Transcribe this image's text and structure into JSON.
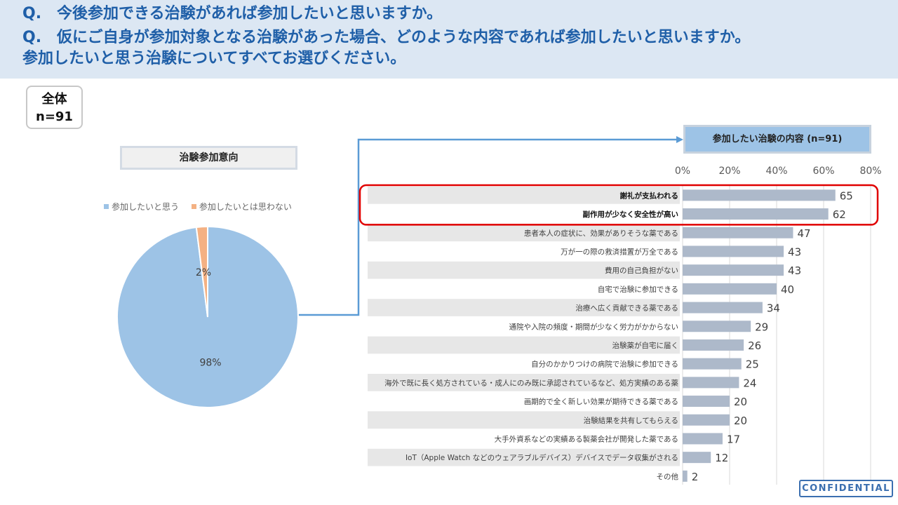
{
  "header": {
    "q1": "Q.　今後参加できる治験があれば参加したいと思いますか。",
    "q2": "Q.　仮にご自身が参加対象となる治験があった場合、どのような内容であれば参加したいと思いますか。",
    "q3": "参加したいと思う治験についてすべてお選びください。"
  },
  "total": {
    "label": "全体",
    "n": "n=91"
  },
  "footer": {
    "confidential": "CONFIDENTIAL"
  },
  "colors": {
    "pie_main": "#9dc3e6",
    "pie_minor": "#f4b183",
    "bar": "#adb9ca",
    "highlight": "#e00000",
    "connector": "#5b9bd5"
  },
  "chart_data": [
    {
      "type": "pie",
      "title": "治験参加意向",
      "legend_position": "top",
      "slices": [
        {
          "label": "参加したいと思う",
          "value": 98,
          "data_label": "98%",
          "color": "#9dc3e6"
        },
        {
          "label": "参加したいとは思わない",
          "value": 2,
          "data_label": "2%",
          "color": "#f4b183"
        }
      ]
    },
    {
      "type": "bar",
      "orientation": "horizontal",
      "title": "参加したい治験の内容 (n=91)",
      "xlim": [
        0,
        80
      ],
      "ticks": [
        "0%",
        "20%",
        "40%",
        "60%",
        "80%"
      ],
      "tick_values": [
        0,
        20,
        40,
        60,
        80
      ],
      "grid": true,
      "highlight_rows": [
        0,
        1
      ],
      "categories": [
        "謝礼が支払われる",
        "副作用が少なく安全性が高い",
        "患者本人の症状に、効果がありそうな薬である",
        "万が一の際の救済措置が万全である",
        "費用の自己負担がない",
        "自宅で治験に参加できる",
        "治療へ広く貢献できる薬である",
        "通院や入院の頻度・期間が少なく労力がかからない",
        "治験薬が自宅に届く",
        "自分のかかりつけの病院で治験に参加できる",
        "海外で既に長く処方されている・成人にのみ既に承認されているなど、処方実績のある薬",
        "画期的で全く新しい効果が期待できる薬である",
        "治験結果を共有してもらえる",
        "大手外資系などの実績ある製薬会社が開発した薬である",
        "IoT（Apple Watch などのウェアラブルデバイス）デバイスでデータ収集がされる",
        "その他"
      ],
      "values": [
        65,
        62,
        47,
        43,
        43,
        40,
        34,
        29,
        26,
        25,
        24,
        20,
        20,
        17,
        12,
        2
      ],
      "value_labels": [
        "65",
        "62",
        "47",
        "43",
        "43",
        "40",
        "34",
        "29",
        "26",
        "25",
        "24",
        "20",
        "20",
        "17",
        "12",
        "2"
      ]
    }
  ]
}
